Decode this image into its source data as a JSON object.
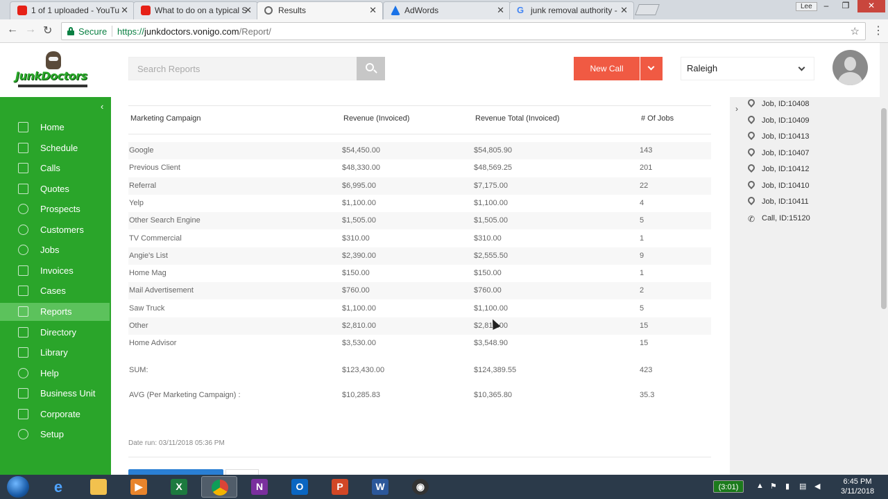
{
  "browser": {
    "tabs": [
      {
        "title": "1 of 1 uploaded - YouTu",
        "icon": "youtube-icon",
        "color": "#e62117"
      },
      {
        "title": "What to do on a typical S",
        "icon": "youtube-icon",
        "color": "#e62117"
      },
      {
        "title": "Results",
        "icon": "clock-icon",
        "color": "#666666"
      },
      {
        "title": "AdWords",
        "icon": "adwords-icon",
        "color": "#1a73e8"
      },
      {
        "title": "junk removal authority -",
        "icon": "google-icon",
        "color": "#4285f4"
      }
    ],
    "user_label": "Lee",
    "secure_label": "Secure",
    "url_scheme": "https://",
    "url_host": "junkdoctors.vonigo.com",
    "url_path": "/Report/"
  },
  "header": {
    "logo_text": "JunkDoctors",
    "search_placeholder": "Search Reports",
    "new_call_label": "New Call",
    "location": "Raleigh"
  },
  "sidebar": {
    "items": [
      {
        "label": "Home",
        "icon": "grid-icon"
      },
      {
        "label": "Schedule",
        "icon": "calendar-icon"
      },
      {
        "label": "Calls",
        "icon": "phone-icon"
      },
      {
        "label": "Quotes",
        "icon": "edit-icon"
      },
      {
        "label": "Prospects",
        "icon": "people-icon"
      },
      {
        "label": "Customers",
        "icon": "person-icon"
      },
      {
        "label": "Jobs",
        "icon": "map-pin-icon"
      },
      {
        "label": "Invoices",
        "icon": "document-icon"
      },
      {
        "label": "Cases",
        "icon": "layers-icon"
      },
      {
        "label": "Reports",
        "icon": "list-icon"
      },
      {
        "label": "Directory",
        "icon": "directory-icon"
      },
      {
        "label": "Library",
        "icon": "book-icon"
      },
      {
        "label": "Help",
        "icon": "help-icon"
      },
      {
        "label": "Business Unit",
        "icon": "building-icon"
      },
      {
        "label": "Corporate",
        "icon": "flag-icon"
      },
      {
        "label": "Setup",
        "icon": "gear-icon"
      }
    ],
    "active": "Reports"
  },
  "report": {
    "columns": [
      "Marketing Campaign",
      "Revenue (Invoiced)",
      "Revenue Total (Invoiced)",
      "# Of Jobs"
    ],
    "rows": [
      [
        "Google",
        "$54,450.00",
        "$54,805.90",
        "143"
      ],
      [
        "Previous Client",
        "$48,330.00",
        "$48,569.25",
        "201"
      ],
      [
        "Referral",
        "$6,995.00",
        "$7,175.00",
        "22"
      ],
      [
        "Yelp",
        "$1,100.00",
        "$1,100.00",
        "4"
      ],
      [
        "Other Search Engine",
        "$1,505.00",
        "$1,505.00",
        "5"
      ],
      [
        "TV Commercial",
        "$310.00",
        "$310.00",
        "1"
      ],
      [
        "Angie's List",
        "$2,390.00",
        "$2,555.50",
        "9"
      ],
      [
        "Home Mag",
        "$150.00",
        "$150.00",
        "1"
      ],
      [
        "Mail Advertisement",
        "$760.00",
        "$760.00",
        "2"
      ],
      [
        "Saw Truck",
        "$1,100.00",
        "$1,100.00",
        "5"
      ],
      [
        "Other",
        "$2,810.00",
        "$2,810.00",
        "15"
      ],
      [
        "Home Advisor",
        "$3,530.00",
        "$3,548.90",
        "15"
      ]
    ],
    "sum": [
      "SUM:",
      "$123,430.00",
      "$124,389.55",
      "423"
    ],
    "avg": [
      "AVG (Per Marketing Campaign) :",
      "$10,285.83",
      "$10,365.80",
      "35.3"
    ],
    "date_run": "Date run: 03/11/2018 05:36 PM"
  },
  "right_panel": {
    "items": [
      {
        "label": "Job, ID:10408",
        "type": "job"
      },
      {
        "label": "Job, ID:10409",
        "type": "job"
      },
      {
        "label": "Job, ID:10413",
        "type": "job"
      },
      {
        "label": "Job, ID:10407",
        "type": "job"
      },
      {
        "label": "Job, ID:10412",
        "type": "job"
      },
      {
        "label": "Job, ID:10410",
        "type": "job"
      },
      {
        "label": "Job, ID:10411",
        "type": "job"
      },
      {
        "label": "Call, ID:15120",
        "type": "call"
      }
    ]
  },
  "taskbar": {
    "apps": [
      {
        "name": "internet-explorer-icon",
        "glyph": "e",
        "color": "#1e88e5"
      },
      {
        "name": "file-explorer-icon",
        "glyph": "",
        "color": "#f2c14e"
      },
      {
        "name": "media-player-icon",
        "glyph": "▶",
        "color": "#e8842c"
      },
      {
        "name": "excel-icon",
        "glyph": "X",
        "color": "#1d7a3f"
      },
      {
        "name": "chrome-icon",
        "glyph": "",
        "color": "#db4437"
      },
      {
        "name": "onenote-icon",
        "glyph": "N",
        "color": "#7a2f9e"
      },
      {
        "name": "outlook-icon",
        "glyph": "O",
        "color": "#0a66c2"
      },
      {
        "name": "powerpoint-icon",
        "glyph": "P",
        "color": "#d24726"
      },
      {
        "name": "word-icon",
        "glyph": "W",
        "color": "#2b579a"
      },
      {
        "name": "obs-icon",
        "glyph": "◉",
        "color": "#333333"
      }
    ],
    "timer": "(3:01)",
    "time": "6:45 PM",
    "date": "3/11/2018"
  },
  "colors": {
    "sidebar_green": "#2aa52a",
    "active_nav": "#5cc25c",
    "new_call": "#f05a43"
  }
}
